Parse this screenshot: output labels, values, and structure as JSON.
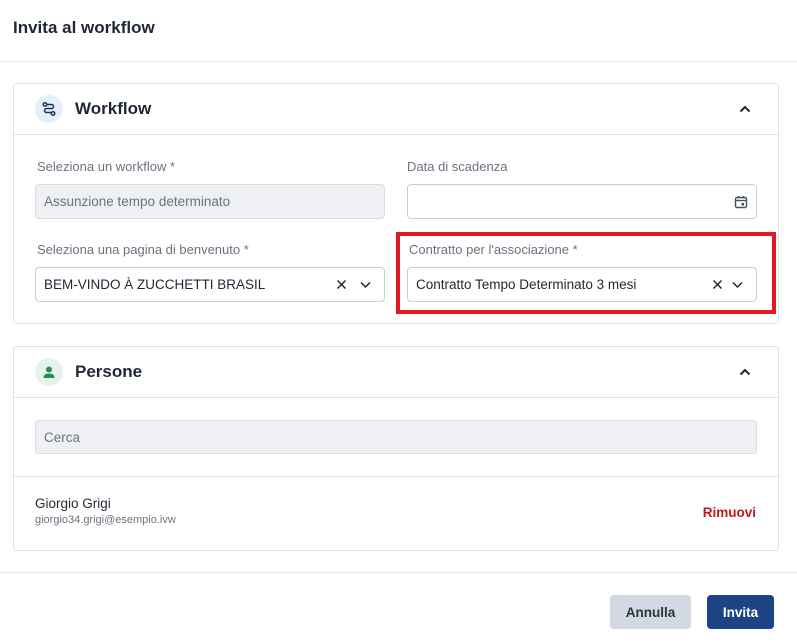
{
  "dialog": {
    "title": "Invita al workflow"
  },
  "workflow_section": {
    "title": "Workflow",
    "select_workflow_label": "Seleziona un workflow",
    "select_workflow_value": "Assunzione tempo determinato",
    "expiry_label": "Data di scadenza",
    "expiry_value": "",
    "welcome_page_label": "Seleziona una pagina di benvenuto",
    "welcome_page_value": "BEM-VINDO À ZUCCHETTI BRASIL",
    "contract_label": "Contratto per l'associazione",
    "contract_value": "Contratto Tempo Determinato 3 mesi",
    "required_marker": "*"
  },
  "people_section": {
    "title": "Persone",
    "search_placeholder": "Cerca",
    "people": [
      {
        "name": "Giorgio Grigi",
        "email": "giorgio34.grigi@esempio.ivw",
        "remove_label": "Rimuovi"
      }
    ]
  },
  "footer": {
    "cancel_label": "Annulla",
    "invite_label": "Invita"
  },
  "colors": {
    "primary": "#1d4585",
    "danger": "#c4161c",
    "highlight": "#e01b24",
    "person_icon": "#2e8b4f"
  }
}
